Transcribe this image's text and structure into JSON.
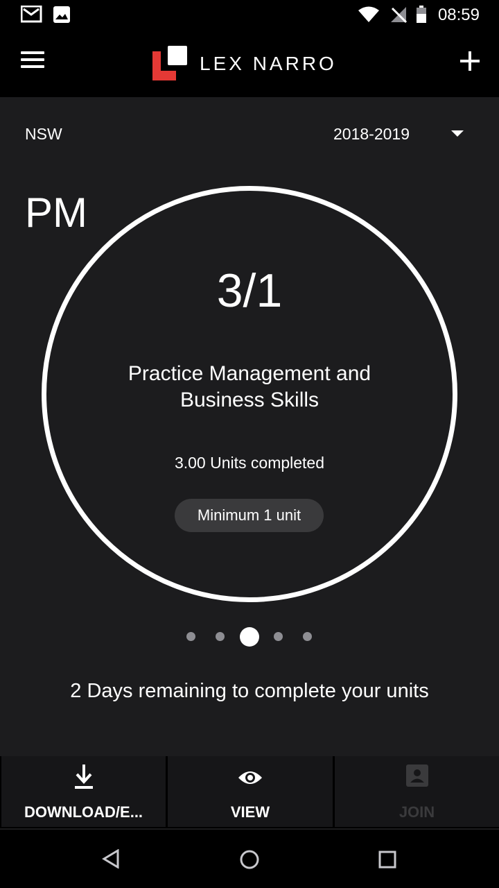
{
  "status_bar": {
    "time": "08:59"
  },
  "header": {
    "brand": "LEX NARRO",
    "brand_color": "#e53935"
  },
  "filters": {
    "region": "NSW",
    "year": "2018-2019"
  },
  "card": {
    "code": "PM",
    "ratio": "3/1",
    "category": "Practice Management and Business Skills",
    "units_completed": "3.00 Units completed",
    "minimum": "Minimum 1 unit",
    "progress_fraction": 1.0
  },
  "pager": {
    "count": 5,
    "active_index": 2
  },
  "footer_message": "2 Days remaining to complete your units",
  "tabs": [
    {
      "label": "DOWNLOAD/E...",
      "icon": "download-icon",
      "enabled": true
    },
    {
      "label": "VIEW",
      "icon": "eye-icon",
      "enabled": true
    },
    {
      "label": "JOIN",
      "icon": "contact-card-icon",
      "enabled": false
    }
  ],
  "nav": {
    "back": "back-icon",
    "home": "home-icon",
    "recents": "recents-icon"
  }
}
